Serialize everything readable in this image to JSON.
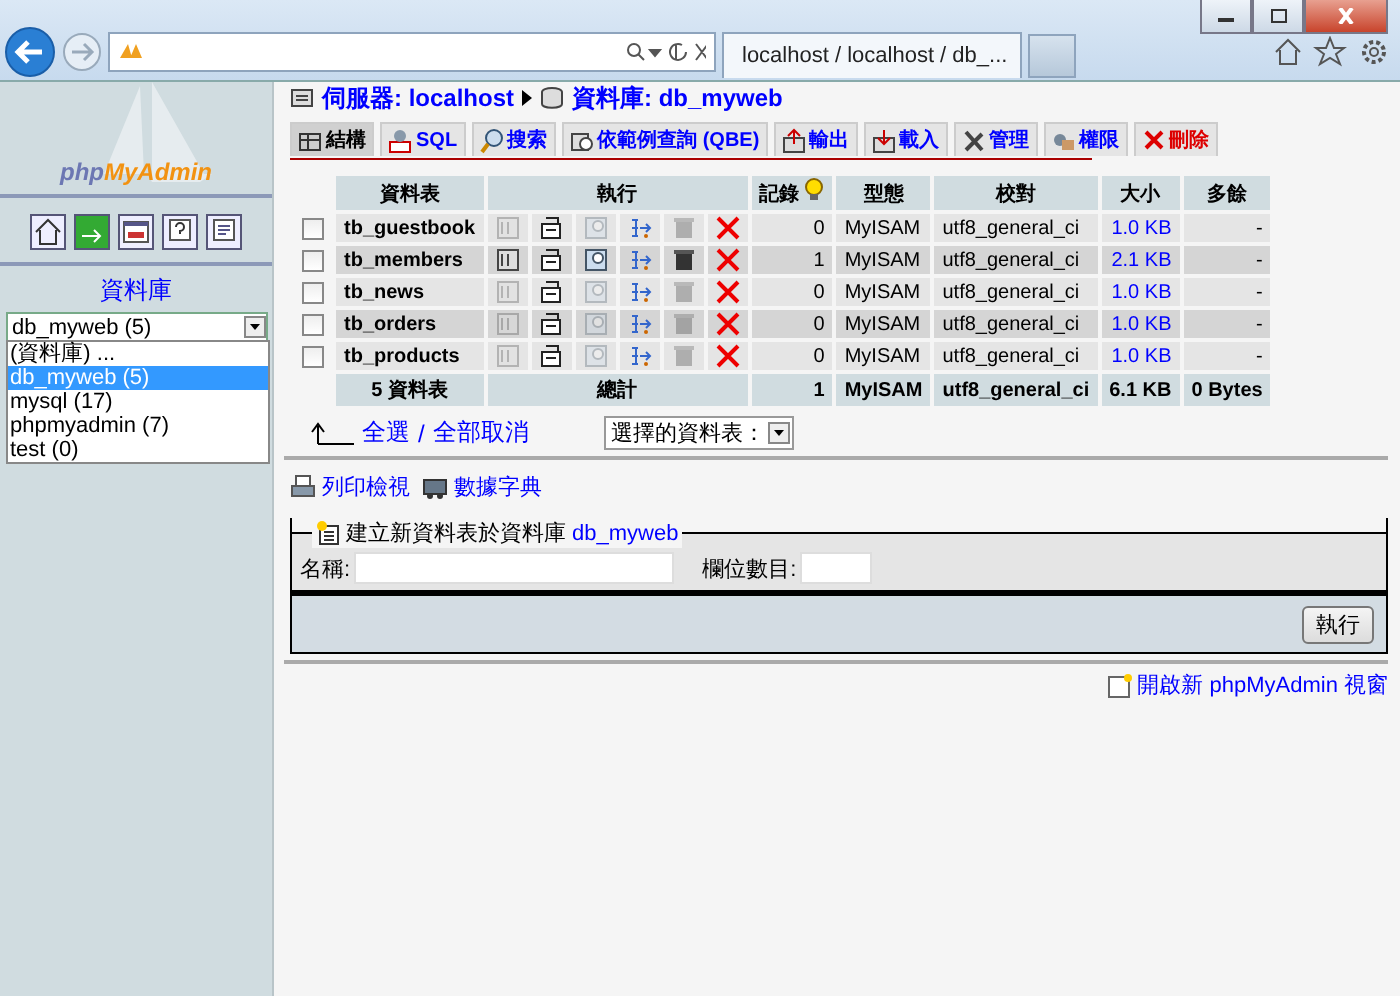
{
  "browser": {
    "tab_title": "localhost / localhost / db_..."
  },
  "sidebar": {
    "logo_php": "php",
    "logo_myadmin": "MyAdmin",
    "heading": "資料庫",
    "select_value": "db_myweb (5)",
    "dropdown_open": true,
    "options": [
      {
        "label": "(資料庫) ...",
        "selected": false
      },
      {
        "label": "db_myweb (5)",
        "selected": true
      },
      {
        "label": "mysql (17)",
        "selected": false
      },
      {
        "label": "phpmyadmin (7)",
        "selected": false
      },
      {
        "label": "test (0)",
        "selected": false
      }
    ]
  },
  "breadcrumb": {
    "server": "伺服器: localhost",
    "database": "資料庫: db_myweb"
  },
  "tabs": [
    {
      "label": "結構",
      "selected": true,
      "kind": "structure"
    },
    {
      "label": "SQL",
      "selected": false,
      "kind": "sql"
    },
    {
      "label": "搜索",
      "selected": false,
      "kind": "search"
    },
    {
      "label": "依範例查詢 (QBE)",
      "selected": false,
      "kind": "query"
    },
    {
      "label": "輸出",
      "selected": false,
      "kind": "export"
    },
    {
      "label": "載入",
      "selected": false,
      "kind": "import"
    },
    {
      "label": "管理",
      "selected": false,
      "kind": "tools"
    },
    {
      "label": "權限",
      "selected": false,
      "kind": "privileges"
    },
    {
      "label": "刪除",
      "selected": false,
      "kind": "drop"
    }
  ],
  "table": {
    "columns": [
      "資料表",
      "執行",
      "記錄",
      "型態",
      "校對",
      "大小",
      "多餘"
    ],
    "rows": [
      {
        "name": "tb_guestbook",
        "checked": false,
        "has_data": false,
        "records": "0",
        "type": "MyISAM",
        "collation": "utf8_general_ci",
        "size": "1.0 KB",
        "overhead": "-"
      },
      {
        "name": "tb_members",
        "checked": false,
        "has_data": true,
        "records": "1",
        "type": "MyISAM",
        "collation": "utf8_general_ci",
        "size": "2.1 KB",
        "overhead": "-"
      },
      {
        "name": "tb_news",
        "checked": false,
        "has_data": false,
        "records": "0",
        "type": "MyISAM",
        "collation": "utf8_general_ci",
        "size": "1.0 KB",
        "overhead": "-"
      },
      {
        "name": "tb_orders",
        "checked": false,
        "has_data": false,
        "records": "0",
        "type": "MyISAM",
        "collation": "utf8_general_ci",
        "size": "1.0 KB",
        "overhead": "-"
      },
      {
        "name": "tb_products",
        "checked": false,
        "has_data": false,
        "records": "0",
        "type": "MyISAM",
        "collation": "utf8_general_ci",
        "size": "1.0 KB",
        "overhead": "-"
      }
    ],
    "totals": {
      "name": "5 資料表",
      "label": "總計",
      "records": "1",
      "type": "MyISAM",
      "collation": "utf8_general_ci",
      "size": "6.1 KB",
      "overhead": "0 Bytes"
    }
  },
  "selection": {
    "check_all": "全選",
    "separator": "/",
    "uncheck_all": "全部取消",
    "with_selected": "選擇的資料表："
  },
  "links": [
    {
      "label": "列印檢視",
      "kind": "print"
    },
    {
      "label": "數據字典",
      "kind": "dictionary"
    }
  ],
  "create_table": {
    "legend": "建立新資料表於資料庫",
    "database": "db_myweb",
    "name_label": "名稱:",
    "fields_label": "欄位數目:",
    "button": "執行"
  },
  "footer_link": "開啟新 phpMyAdmin 視窗"
}
